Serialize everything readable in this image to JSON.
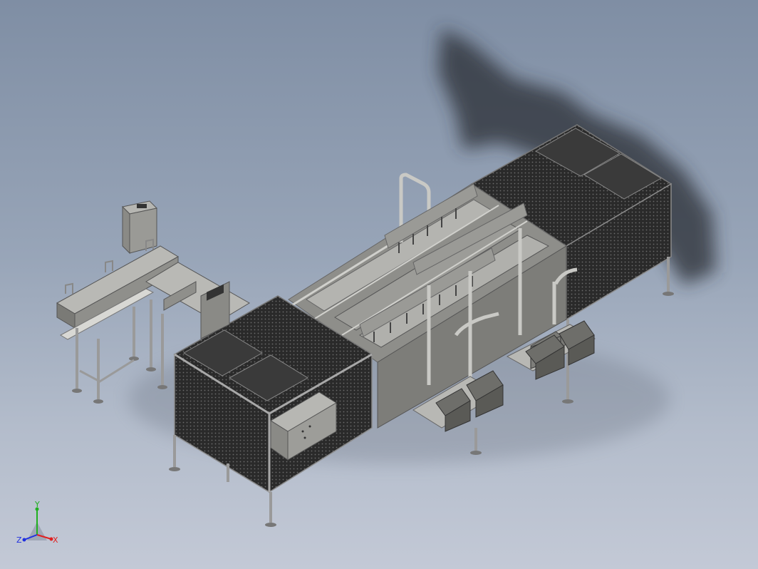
{
  "viewport": {
    "background_top": "#7f8ea4",
    "background_bottom": "#c3c9d6"
  },
  "model": {
    "description_icon": "industrial-filling-conveyor-machine-3d-model",
    "frame_color": "#9a9a9a",
    "panel_color": "#2b2b2b",
    "metal_color": "#a9a9a5"
  },
  "triad": {
    "x_label": "X",
    "y_label": "Y",
    "z_label": "Z",
    "x_color": "#e02020",
    "y_color": "#20b020",
    "z_color": "#2030e0"
  }
}
